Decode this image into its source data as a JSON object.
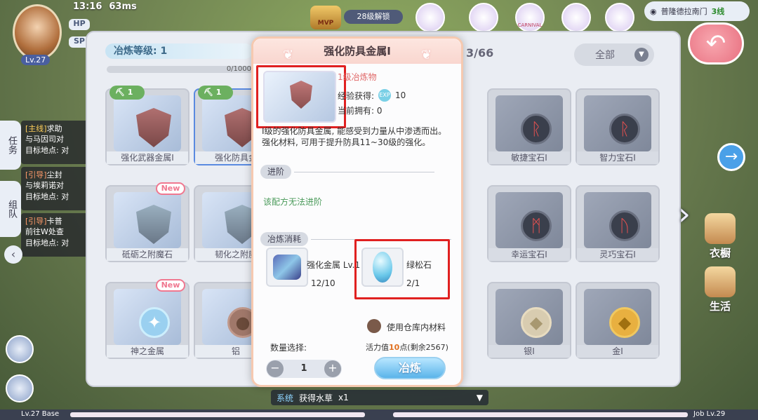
{
  "hud": {
    "time": "13:16",
    "ping": "63ms",
    "hp_label": "HP",
    "sp_label": "SP",
    "level": "Lv.27",
    "unlock_label": "28级解锁",
    "mvp_label": "MVP",
    "carnival_label": "CARNIVAL",
    "map_name": "普隆德拉南门",
    "map_line": "3线"
  },
  "quests": [
    {
      "tag": "[主线]",
      "l1": "求助",
      "l2": "与马因司对",
      "l3": "目标地点: 对"
    },
    {
      "tag": "[引导]",
      "l1": "尘封",
      "l2": "与埃莉诺对",
      "l3": "目标地点: 对"
    },
    {
      "tag": "[引导]",
      "l1": "卡普",
      "l2": "前往W处查",
      "l3": "目标地点: 对"
    }
  ],
  "left_tabs": {
    "mission": "任务",
    "team": "组队"
  },
  "panel": {
    "refine_level": "冶炼等级: 1",
    "progress": "0/1000",
    "count": "3/66",
    "filter": "全部",
    "filter_icon": "chevron-down-icon"
  },
  "cards": [
    {
      "label": "强化武器金属Ⅰ",
      "badge": "1",
      "new": false
    },
    {
      "label": "强化防具金",
      "badge": "1",
      "new": false
    },
    {
      "label": "敏捷宝石Ⅰ"
    },
    {
      "label": "智力宝石Ⅰ"
    },
    {
      "label": "砥砺之附魔石",
      "new": true
    },
    {
      "label": "韧化之附魔"
    },
    {
      "label": "幸运宝石Ⅰ"
    },
    {
      "label": "灵巧宝石Ⅰ"
    },
    {
      "label": "神之金属",
      "new": true
    },
    {
      "label": "铝"
    },
    {
      "label": "银Ⅰ"
    },
    {
      "label": "金Ⅰ"
    }
  ],
  "new_label": "New",
  "dialog": {
    "title": "强化防具金属Ⅰ",
    "item_type": "1级冶炼物",
    "exp_label": "经验获得:",
    "exp_value": "10",
    "own_label": "当前拥有:",
    "own_value": "0",
    "desc1": "Ⅰ级的强化防具金属, 能感受到力量从中渗透而出。",
    "desc2": "强化材料, 可用于提升防具11~30级的强化。",
    "advance_label": "进阶",
    "no_advance": "该配方无法进阶",
    "cost_label": "冶炼消耗",
    "mat1_name": "强化金属 Lv.1",
    "mat1_num": "12/10",
    "mat2_name": "绿松石",
    "mat2_num": "2/1",
    "use_storage": "使用仓库内材料",
    "qty_label": "数量选择:",
    "qty_value": "1",
    "stamina_pre": "活力值",
    "stamina_val": "10",
    "stamina_post": "点(剩余2567)",
    "refine_button": "冶炼"
  },
  "side": {
    "wardrobe": "衣橱",
    "life": "生活"
  },
  "bottom": {
    "base": "Lv.27 Base",
    "job": "Job Lv.29",
    "chat_tag": "系统",
    "chat_text": "获得水草",
    "chat_count": "x1"
  },
  "colors": {
    "accent": "#5ab4ea",
    "highlight": "#e02020"
  }
}
